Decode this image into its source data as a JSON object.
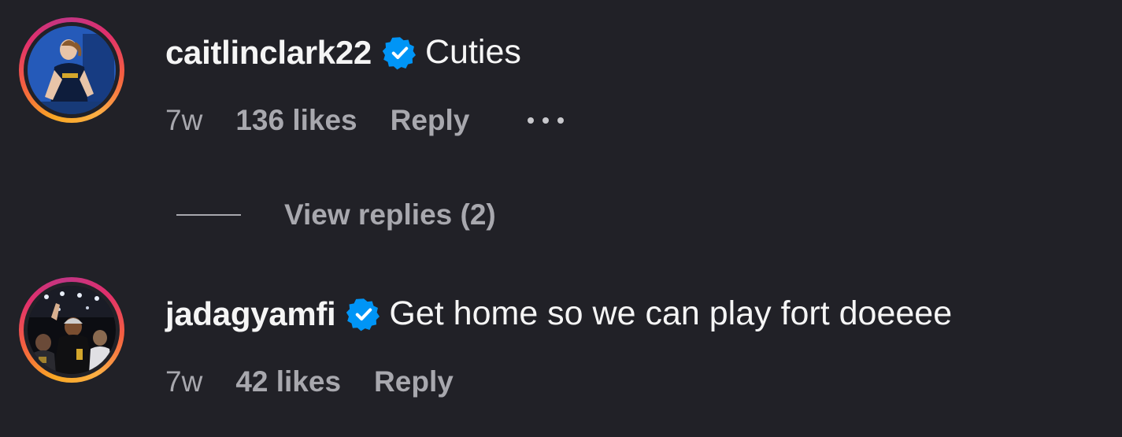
{
  "comments": [
    {
      "username": "caitlinclark22",
      "verified": true,
      "text": "Cuties",
      "time": "7w",
      "likes": "136 likes",
      "reply_label": "Reply",
      "avatar_icon": "profile-photo-player-blue-court"
    },
    {
      "username": "jadagyamfi",
      "verified": true,
      "text": "Get home so we can play fort doeeee",
      "time": "7w",
      "likes": "42 likes",
      "reply_label": "Reply",
      "avatar_icon": "profile-photo-arena-celebration"
    }
  ],
  "view_replies": {
    "label": "View replies (2)"
  },
  "colors": {
    "background": "#212127",
    "text_primary": "#f5f5f5",
    "text_secondary": "#a8a8ae",
    "verified_badge": "#0095f6"
  }
}
